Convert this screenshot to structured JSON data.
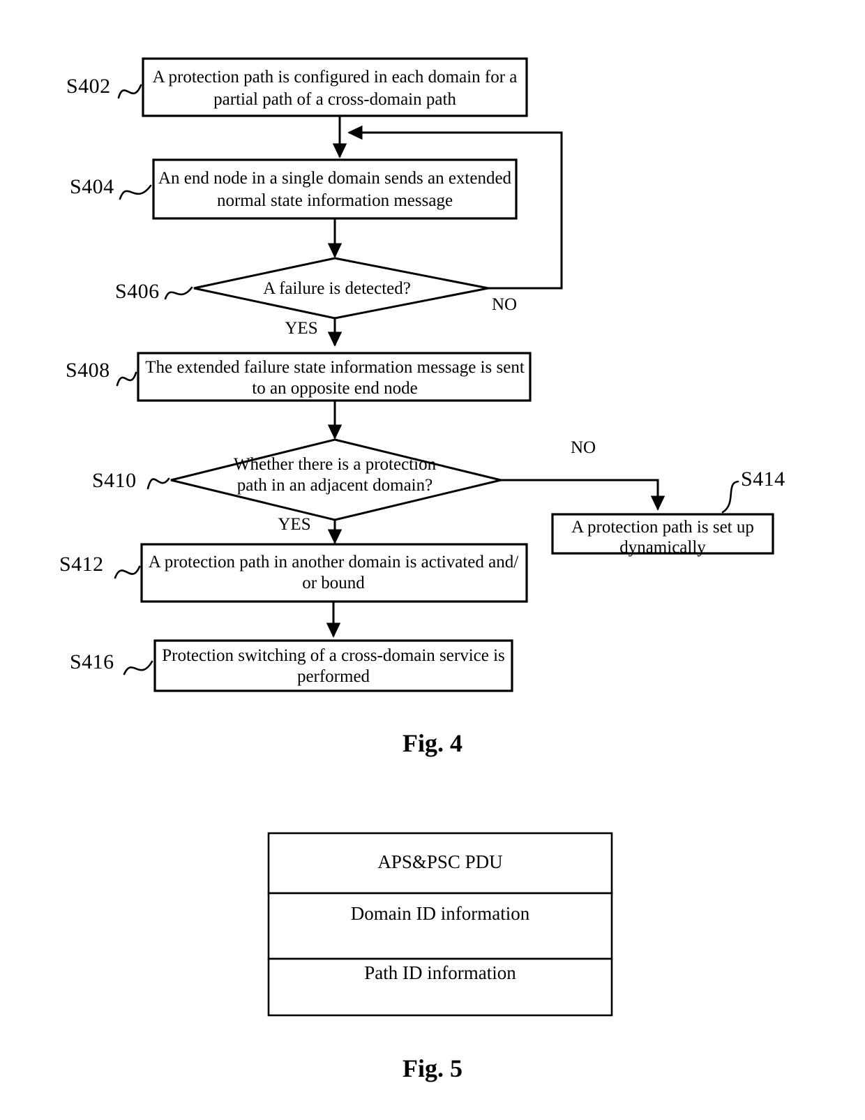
{
  "page": {
    "background": "#ffffff",
    "ink": "#000000"
  },
  "figure4": {
    "caption": "Fig. 4",
    "steps": {
      "s402": {
        "id": "S402",
        "text_line1": "A protection path is configured in each domain for a",
        "text_line2": "partial path of a cross-domain path"
      },
      "s404": {
        "id": "S404",
        "text_line1": "An end node in a single domain sends an extended",
        "text_line2": "normal state information message"
      },
      "s406": {
        "id": "S406",
        "text_line1": "A failure is detected?"
      },
      "s408": {
        "id": "S408",
        "text_line1": "The extended failure state information message is sent",
        "text_line2": "to an opposite end node"
      },
      "s410": {
        "id": "S410",
        "text_line1": "Whether there is a protection",
        "text_line2": "path in an adjacent domain?"
      },
      "s412": {
        "id": "S412",
        "text_line1": "A protection path in another domain is activated and/",
        "text_line2": "or bound"
      },
      "s414": {
        "id": "S414",
        "text_line1": "A protection path is set up",
        "text_line2": "dynamically"
      },
      "s416": {
        "id": "S416",
        "text_line1": "Protection switching of a cross-domain service is",
        "text_line2": "performed"
      }
    },
    "branches": {
      "s406_no": "NO",
      "s406_yes": "YES",
      "s410_no": "NO",
      "s410_yes": "YES"
    }
  },
  "figure5": {
    "caption": "Fig. 5",
    "rows": [
      {
        "label": "APS&PSC PDU"
      },
      {
        "label": "Domain ID information"
      },
      {
        "label": "Path ID information"
      }
    ]
  }
}
